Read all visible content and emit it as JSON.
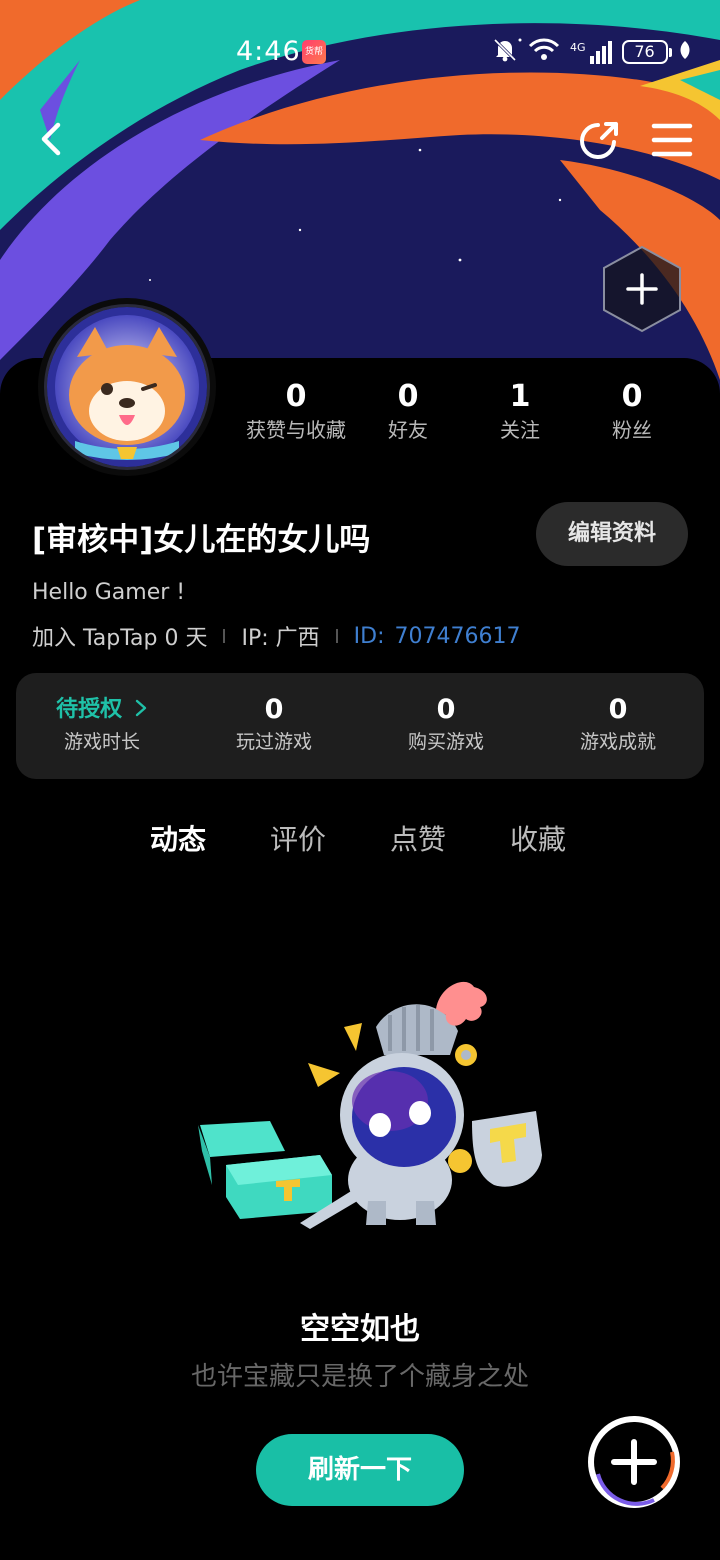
{
  "status_bar": {
    "time": "4:46",
    "badge": "货帮",
    "network": "4G",
    "battery": "76"
  },
  "profile": {
    "stats": [
      {
        "value": "0",
        "label": "获赞与收藏"
      },
      {
        "value": "0",
        "label": "好友"
      },
      {
        "value": "1",
        "label": "关注"
      },
      {
        "value": "0",
        "label": "粉丝"
      }
    ],
    "username": "[审核中]女儿在的女儿吗",
    "edit_label": "编辑资料",
    "bio": "Hello Gamer !",
    "joined": "加入 TapTap 0 天",
    "ip": "IP:  广西",
    "id_label": "ID:",
    "id_value": "707476617"
  },
  "game_stats": [
    {
      "value": "待授权",
      "label": "游戏时长"
    },
    {
      "value": "0",
      "label": "玩过游戏"
    },
    {
      "value": "0",
      "label": "购买游戏"
    },
    {
      "value": "0",
      "label": "游戏成就"
    }
  ],
  "tabs": [
    "动态",
    "评价",
    "点赞",
    "收藏"
  ],
  "empty": {
    "title": "空空如也",
    "subtitle": "也许宝藏只是换了个藏身之处",
    "refresh_label": "刷新一下"
  },
  "colors": {
    "accent": "#19bfa6",
    "id_blue": "#3f7fd0",
    "card": "#1e1e1e"
  },
  "icons": [
    "back-icon",
    "share-icon",
    "menu-icon",
    "plus-icon",
    "bell-off-icon",
    "wifi-icon",
    "signal-icon",
    "battery-icon",
    "chevron-right-icon"
  ]
}
